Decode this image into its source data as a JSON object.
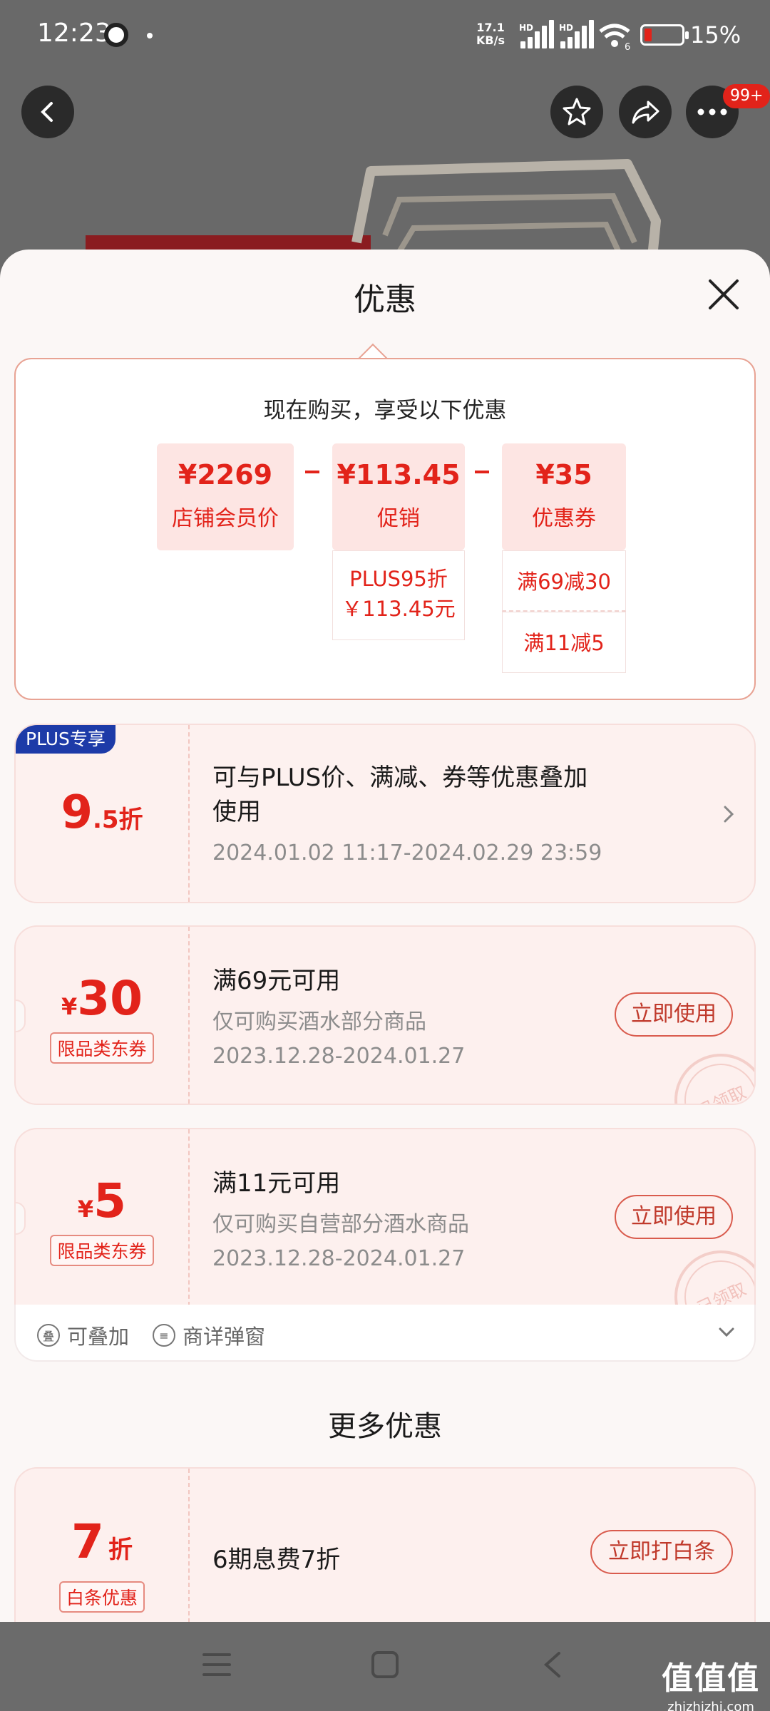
{
  "status_bar": {
    "time": "12:23",
    "net_speed_value": "17.1",
    "net_speed_unit": "KB/s",
    "hd_label": "HD",
    "wifi_sub": "6",
    "battery_pct": "15%"
  },
  "nav": {
    "badge": "99+"
  },
  "sheet": {
    "title": "优惠",
    "summary": {
      "heading": "现在购买，享受以下优惠",
      "price": {
        "amount": "¥2269",
        "label": "店铺会员价"
      },
      "promo": {
        "amount": "¥113.45",
        "label": "促销",
        "detail_line1": "PLUS95折",
        "detail_line2": "￥113.45元"
      },
      "coupon": {
        "amount": "¥35",
        "label": "优惠券",
        "detail_1": "满69减30",
        "detail_2": "满11减5"
      }
    },
    "plus_card": {
      "tag": "PLUS专享",
      "discount_big": "9",
      "discount_small": ".5折",
      "title_line1": "可与PLUS价、满减、券等优惠叠加",
      "title_line2": "使用",
      "date": "2024.01.02 11:17-2024.02.29 23:59"
    },
    "coupons": [
      {
        "currency": "¥",
        "amount": "30",
        "tag": "限品类东券",
        "title": "满69元可用",
        "subtitle": "仅可购买酒水部分商品",
        "date": "2023.12.28-2024.01.27",
        "button": "立即使用",
        "stamp": "已领取"
      },
      {
        "currency": "¥",
        "amount": "5",
        "tag": "限品类东券",
        "title": "满11元可用",
        "subtitle": "仅可购买自营部分酒水商品",
        "date": "2023.12.28-2024.01.27",
        "button": "立即使用",
        "stamp": "已领取"
      }
    ],
    "footer": {
      "stackable_icon": "叠",
      "stackable": "可叠加",
      "popup_icon": "≡",
      "popup": "商详弹窗"
    },
    "more_title": "更多优惠",
    "baitiao": {
      "discount_big": "7",
      "discount_small": "折",
      "tag": "白条优惠",
      "title": "6期息费7折",
      "button": "立即打白条"
    }
  },
  "watermark": {
    "big": "值值值",
    "small": "zhizhizhi.com"
  },
  "colors": {
    "accent": "#e2231a",
    "plus_blue": "#1d3ba8",
    "sheet_bg": "#fbf7f6"
  }
}
